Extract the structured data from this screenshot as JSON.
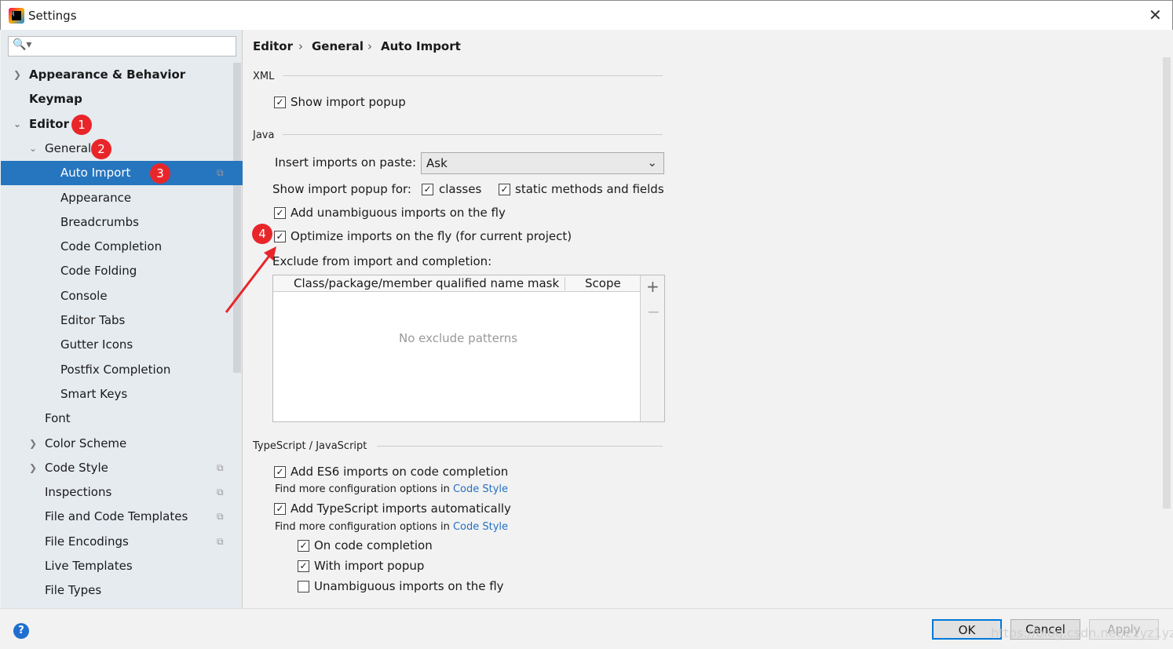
{
  "window": {
    "title": "Settings"
  },
  "sidebar": {
    "search_placeholder": "",
    "items": [
      {
        "label": "Appearance & Behavior"
      },
      {
        "label": "Keymap"
      },
      {
        "label": "Editor"
      },
      {
        "label": "General"
      },
      {
        "label": "Auto Import"
      },
      {
        "label": "Appearance"
      },
      {
        "label": "Breadcrumbs"
      },
      {
        "label": "Code Completion"
      },
      {
        "label": "Code Folding"
      },
      {
        "label": "Console"
      },
      {
        "label": "Editor Tabs"
      },
      {
        "label": "Gutter Icons"
      },
      {
        "label": "Postfix Completion"
      },
      {
        "label": "Smart Keys"
      },
      {
        "label": "Font"
      },
      {
        "label": "Color Scheme"
      },
      {
        "label": "Code Style"
      },
      {
        "label": "Inspections"
      },
      {
        "label": "File and Code Templates"
      },
      {
        "label": "File Encodings"
      },
      {
        "label": "Live Templates"
      },
      {
        "label": "File Types"
      }
    ]
  },
  "annotations": [
    "1",
    "2",
    "3",
    "4"
  ],
  "breadcrumb": [
    "Editor",
    "General",
    "Auto Import"
  ],
  "xml": {
    "title": "XML",
    "show_popup": "Show import popup"
  },
  "java": {
    "title": "Java",
    "insert_label": "Insert imports on paste:",
    "insert_value": "Ask",
    "popup_for": "Show import popup for:",
    "classes": "classes",
    "static": "static methods and fields",
    "unambiguous": "Add unambiguous imports on the fly",
    "optimize": "Optimize imports on the fly (for current project)",
    "exclude": "Exclude from import and completion:",
    "col1": "Class/package/member qualified name mask",
    "col2": "Scope",
    "empty": "No exclude patterns"
  },
  "ts": {
    "title": "TypeScript / JavaScript",
    "es6": "Add ES6 imports on code completion",
    "find_more": "Find more configuration options in",
    "code_style": "Code Style",
    "auto": "Add TypeScript imports automatically",
    "on_completion": "On code completion",
    "with_popup": "With import popup",
    "unamb": "Unambiguous imports on the fly"
  },
  "buttons": {
    "ok": "OK",
    "cancel": "Cancel",
    "apply": "Apply",
    "help": "?"
  },
  "watermark": "https://blog.csdn.net/z1yz1yz1y",
  "colors": {
    "selection": "#2675bf",
    "badge": "#e8262a",
    "link": "#2470c2"
  }
}
